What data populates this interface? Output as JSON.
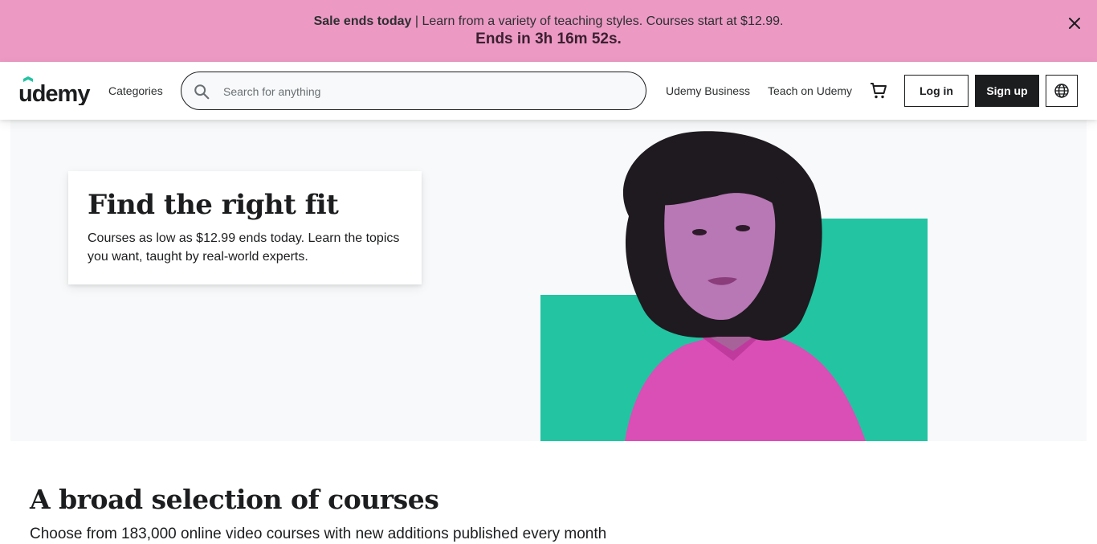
{
  "banner": {
    "bold": "Sale ends today",
    "text": " | Learn from a variety of teaching styles. Courses start at $12.99.",
    "countdown": "Ends in 3h 16m 52s."
  },
  "header": {
    "logo": "udemy",
    "categories": "Categories",
    "search_placeholder": "Search for anything",
    "business_link": "Udemy Business",
    "teach_link": "Teach on Udemy",
    "login_label": "Log in",
    "signup_label": "Sign up"
  },
  "hero": {
    "title": "Find the right fit",
    "text": "Courses as low as $12.99 ends today. Learn the topics you want, taught by real-world experts."
  },
  "section": {
    "title": "A broad selection of courses",
    "subtitle": "Choose from 183,000 online video courses with new additions published every month"
  },
  "colors": {
    "banner": "#ec9ac4",
    "teal": "#22c4a2",
    "magenta": "#d94fb5",
    "dark": "#1c1d1f"
  },
  "icons": [
    "close-icon",
    "search-icon",
    "cart-icon",
    "globe-icon"
  ]
}
